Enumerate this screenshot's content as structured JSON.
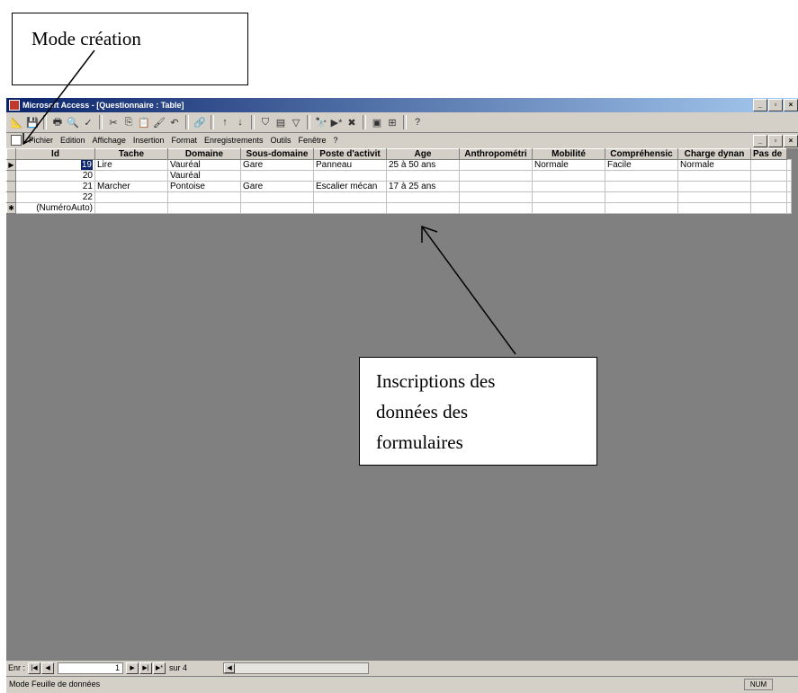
{
  "callouts": {
    "top": "Mode création",
    "middle": [
      "Inscriptions des",
      "données des",
      "formulaires"
    ]
  },
  "window": {
    "title": "Microsoft Access - [Questionnaire : Table]"
  },
  "menu": {
    "items": [
      "Fichier",
      "Edition",
      "Affichage",
      "Insertion",
      "Format",
      "Enregistrements",
      "Outils",
      "Fenêtre",
      "?"
    ]
  },
  "table": {
    "columns": [
      "Id",
      "Tache",
      "Domaine",
      "Sous-domaine",
      "Poste d'activit",
      "Age",
      "Anthropométri",
      "Mobilité",
      "Compréhensic",
      "Charge dynan",
      "Pas de"
    ],
    "rows": [
      {
        "marker": "▶",
        "cells": [
          "19",
          "Lire",
          "Vauréal",
          "Gare",
          "Panneau",
          "25 à 50 ans",
          "",
          "Normale",
          "Facile",
          "Normale",
          ""
        ]
      },
      {
        "marker": "",
        "cells": [
          "20",
          "",
          "Vauréal",
          "",
          "",
          "",
          "",
          "",
          "",
          "",
          ""
        ]
      },
      {
        "marker": "",
        "cells": [
          "21",
          "Marcher",
          "Pontoise",
          "Gare",
          "Escalier mécan",
          "17 à 25 ans",
          "",
          "",
          "",
          "",
          ""
        ]
      },
      {
        "marker": "",
        "cells": [
          "22",
          "",
          "",
          "",
          "",
          "",
          "",
          "",
          "",
          "",
          ""
        ]
      },
      {
        "marker": "✱",
        "cells": [
          "(NuméroAuto)",
          "",
          "",
          "",
          "",
          "",
          "",
          "",
          "",
          "",
          ""
        ]
      }
    ]
  },
  "nav": {
    "label": "Enr :",
    "current": "1",
    "total": "sur 4"
  },
  "status": {
    "mode": "Mode Feuille de données",
    "indicator": "NUM"
  }
}
